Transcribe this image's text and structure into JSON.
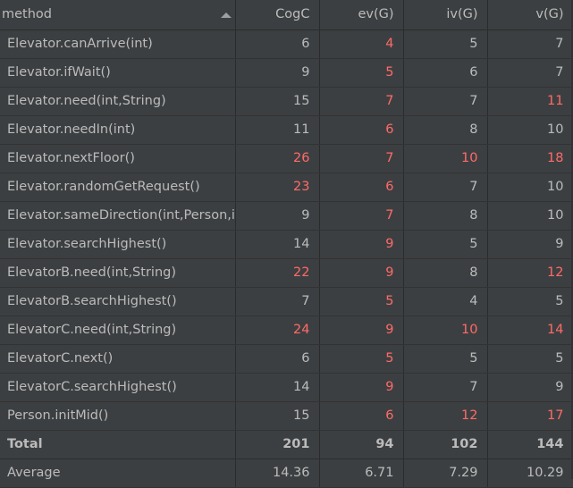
{
  "table": {
    "headers": [
      "method",
      "CogC",
      "ev(G)",
      "iv(G)",
      "v(G)"
    ],
    "rows": [
      {
        "method": "Elevator.canArrive(int)",
        "values": [
          "6",
          "4",
          "5",
          "7"
        ],
        "flags": [
          false,
          true,
          false,
          false
        ]
      },
      {
        "method": "Elevator.ifWait()",
        "values": [
          "9",
          "5",
          "6",
          "7"
        ],
        "flags": [
          false,
          true,
          false,
          false
        ]
      },
      {
        "method": "Elevator.need(int,String)",
        "values": [
          "15",
          "7",
          "7",
          "11"
        ],
        "flags": [
          false,
          true,
          false,
          true
        ]
      },
      {
        "method": "Elevator.needIn(int)",
        "values": [
          "11",
          "6",
          "8",
          "10"
        ],
        "flags": [
          false,
          true,
          false,
          false
        ]
      },
      {
        "method": "Elevator.nextFloor()",
        "values": [
          "26",
          "7",
          "10",
          "18"
        ],
        "flags": [
          true,
          true,
          true,
          true
        ]
      },
      {
        "method": "Elevator.randomGetRequest()",
        "values": [
          "23",
          "6",
          "7",
          "10"
        ],
        "flags": [
          true,
          true,
          false,
          false
        ]
      },
      {
        "method": "Elevator.sameDirection(int,Person,i",
        "values": [
          "9",
          "7",
          "8",
          "10"
        ],
        "flags": [
          false,
          true,
          false,
          false
        ]
      },
      {
        "method": "Elevator.searchHighest()",
        "values": [
          "14",
          "9",
          "5",
          "9"
        ],
        "flags": [
          false,
          true,
          false,
          false
        ]
      },
      {
        "method": "ElevatorB.need(int,String)",
        "values": [
          "22",
          "9",
          "8",
          "12"
        ],
        "flags": [
          true,
          true,
          false,
          true
        ]
      },
      {
        "method": "ElevatorB.searchHighest()",
        "values": [
          "7",
          "5",
          "4",
          "5"
        ],
        "flags": [
          false,
          true,
          false,
          false
        ]
      },
      {
        "method": "ElevatorC.need(int,String)",
        "values": [
          "24",
          "9",
          "10",
          "14"
        ],
        "flags": [
          true,
          true,
          true,
          true
        ]
      },
      {
        "method": "ElevatorC.next()",
        "values": [
          "6",
          "5",
          "5",
          "5"
        ],
        "flags": [
          false,
          true,
          false,
          false
        ]
      },
      {
        "method": "ElevatorC.searchHighest()",
        "values": [
          "14",
          "9",
          "7",
          "9"
        ],
        "flags": [
          false,
          true,
          false,
          false
        ]
      },
      {
        "method": "Person.initMid()",
        "values": [
          "15",
          "6",
          "12",
          "17"
        ],
        "flags": [
          false,
          true,
          true,
          true
        ]
      }
    ],
    "total": {
      "label": "Total",
      "values": [
        "201",
        "94",
        "102",
        "144"
      ]
    },
    "average": {
      "label": "Average",
      "values": [
        "14.36",
        "6.71",
        "7.29",
        "10.29"
      ]
    }
  },
  "colors": {
    "flag": "#ff6b68",
    "text": "#bbbbbb",
    "background": "#3c3f41",
    "accent": "#4a88c7"
  }
}
